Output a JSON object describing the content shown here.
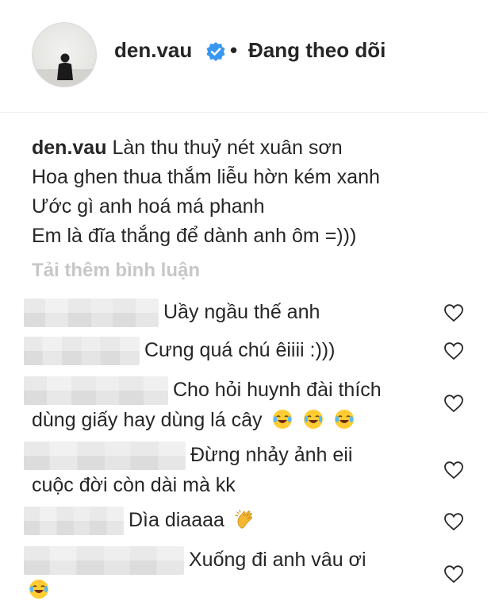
{
  "header": {
    "username": "den.vau",
    "separator": "•",
    "follow_status": "Đang theo dõi"
  },
  "caption": {
    "username": "den.vau",
    "lines": [
      "Làn thu thuỷ nét xuân sơn",
      "Hoa ghen thua thắm liễu hờn kém xanh",
      "Ước gì anh hoá má phanh",
      "Em là đĩa thắng để dành anh ôm =)))"
    ]
  },
  "load_more": "Tải thêm bình luận",
  "comments": [
    {
      "text": "Uầy ngầu thế anh",
      "emoji": []
    },
    {
      "text": "Cưng quá chú êiiii :)))",
      "emoji": []
    },
    {
      "text": "Cho hỏi huynh đài thích",
      "text2": "dùng giấy hay dùng lá cây",
      "emoji": [
        "joy-emoji",
        "joy-emoji",
        "joy-emoji"
      ]
    },
    {
      "text": "Đừng nhảy ảnh eii",
      "text2": "cuộc đời còn dài mà kk",
      "emoji": []
    },
    {
      "text": "Dìa diaaaa",
      "emoji": [
        "clap-emoji"
      ]
    },
    {
      "text": "Xuống đi anh vâu ơi",
      "emoji": [
        "joy-emoji"
      ]
    }
  ],
  "colors": {
    "text": "#262626",
    "verified": "#3897f0",
    "muted": "#c7c7c7",
    "heart_outline": "#262626"
  },
  "icons": [
    "verified-badge-icon",
    "heart-icon",
    "joy-emoji",
    "clap-emoji"
  ]
}
